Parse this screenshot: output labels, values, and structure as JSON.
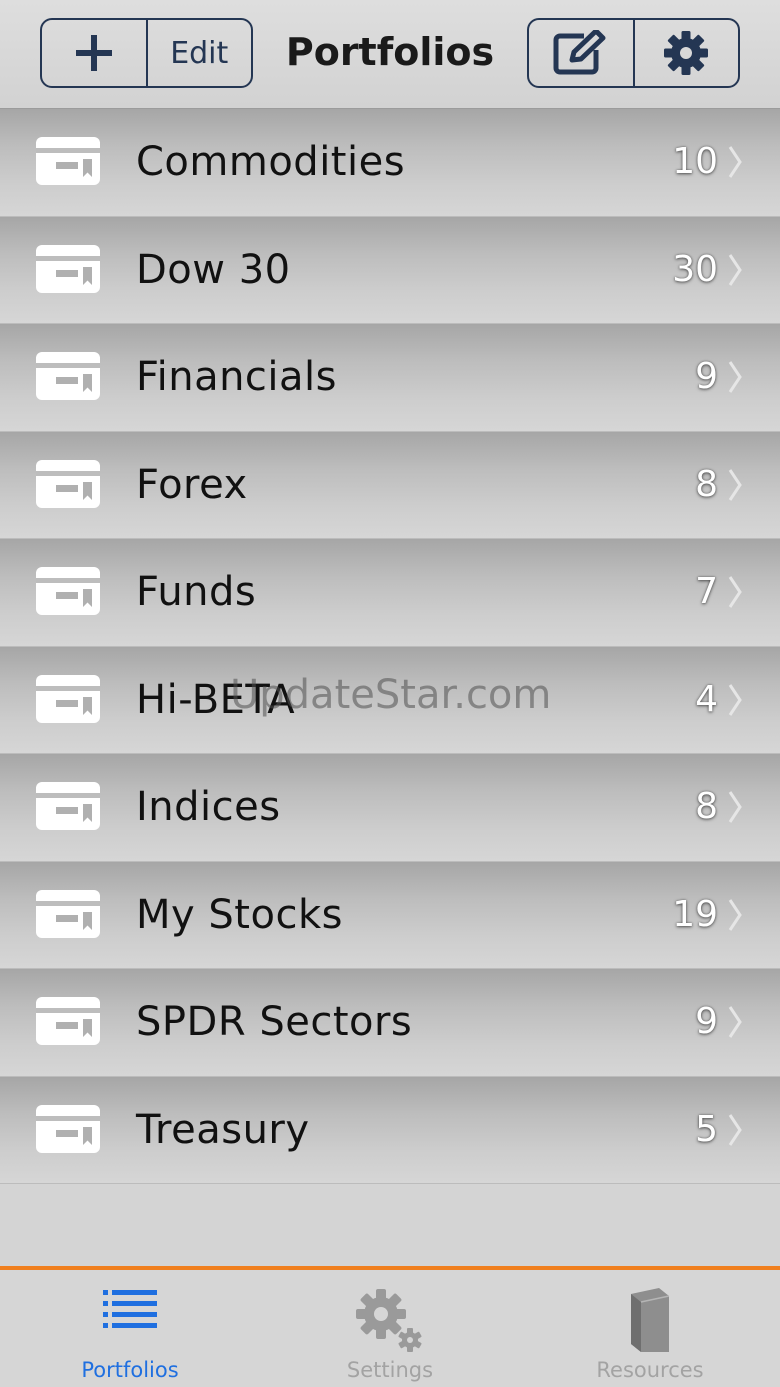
{
  "navbar": {
    "title": "Portfolios",
    "edit_label": "Edit",
    "add_icon": "plus-icon",
    "compose_icon": "compose-icon",
    "settings_icon": "gear-icon"
  },
  "portfolios": [
    {
      "name": "Commodities",
      "count": "10"
    },
    {
      "name": "Dow 30",
      "count": "30"
    },
    {
      "name": "Financials",
      "count": "9"
    },
    {
      "name": "Forex",
      "count": "8"
    },
    {
      "name": "Funds",
      "count": "7"
    },
    {
      "name": "Hi-BETA",
      "count": "4"
    },
    {
      "name": "Indices",
      "count": "8"
    },
    {
      "name": "My Stocks",
      "count": "19"
    },
    {
      "name": "SPDR Sectors",
      "count": "9"
    },
    {
      "name": "Treasury",
      "count": "5"
    }
  ],
  "watermark": "UpdateStar.com",
  "tabbar": {
    "tabs": [
      {
        "label": "Portfolios",
        "icon": "list-icon",
        "active": true
      },
      {
        "label": "Settings",
        "icon": "gears-icon",
        "active": false
      },
      {
        "label": "Resources",
        "icon": "book-icon",
        "active": false
      }
    ]
  },
  "colors": {
    "accent": "#f07f1e",
    "active_tab": "#1f6fe0",
    "nav_button": "#243653"
  }
}
